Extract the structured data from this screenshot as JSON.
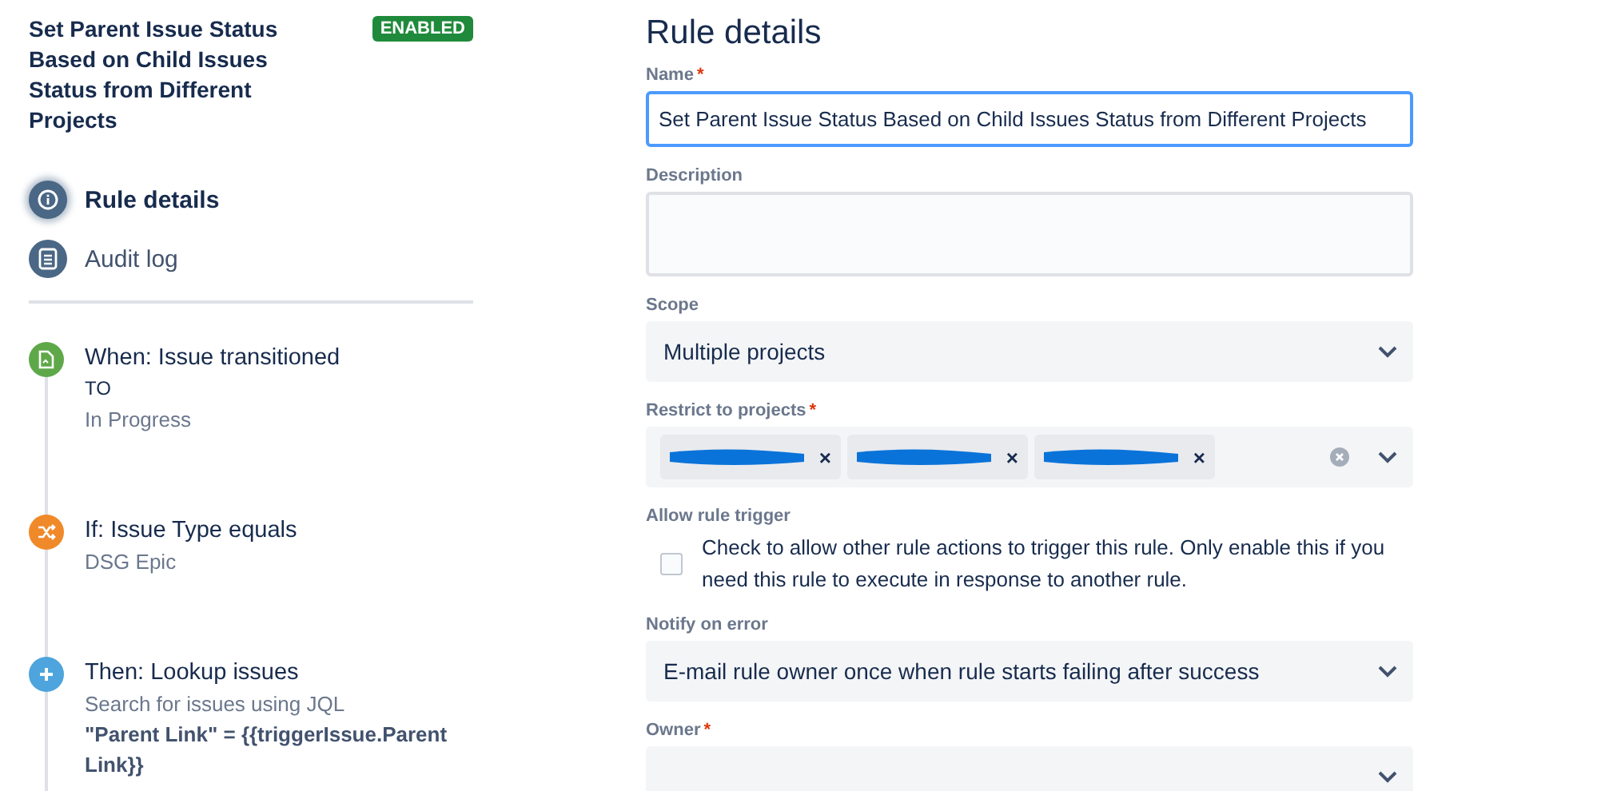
{
  "rule": {
    "title": "Set Parent Issue Status Based on Child Issues Status from Different Projects",
    "status": "ENABLED"
  },
  "nav": [
    {
      "kind": "info",
      "label": "Rule details",
      "selected": true
    },
    {
      "kind": "log",
      "label": "Audit log",
      "selected": false
    }
  ],
  "steps": [
    {
      "kind": "trigger",
      "title": "When: Issue transitioned",
      "lines": [
        {
          "kind": "caps",
          "text": "TO"
        },
        {
          "kind": "plain",
          "text": "In Progress"
        }
      ]
    },
    {
      "kind": "condition",
      "title": "If: Issue Type equals",
      "lines": [
        {
          "kind": "plain",
          "text": "DSG Epic"
        }
      ]
    },
    {
      "kind": "action",
      "title": "Then: Lookup issues",
      "lines": [
        {
          "kind": "plain",
          "text": "Search for issues using JQL"
        },
        {
          "kind": "code",
          "text": "\"Parent Link\" = {{triggerIssue.Parent Link}}"
        }
      ]
    }
  ],
  "form": {
    "heading": "Rule details",
    "fields": [
      {
        "kind": "text",
        "label": "Name",
        "required_mark": "*",
        "value": "Set Parent Issue Status Based on Child Issues Status from Different Projects",
        "focused": true
      },
      {
        "kind": "textarea",
        "label": "Description"
      },
      {
        "kind": "select",
        "label": "Scope",
        "value": "Multiple projects"
      },
      {
        "kind": "tags",
        "label": "Restrict to projects",
        "required_mark": "*",
        "tags": [
          {
            "remove": "×"
          },
          {
            "remove": "×"
          },
          {
            "remove": "×"
          }
        ]
      },
      {
        "kind": "checkbox",
        "label": "Allow rule trigger",
        "text": "Check to allow other rule actions to trigger this rule. Only enable this if you need this rule to execute in response to another rule.",
        "checked": false
      },
      {
        "kind": "select",
        "label": "Notify on error",
        "value": "E-mail rule owner once when rule starts failing after success"
      },
      {
        "kind": "select",
        "label": "Owner",
        "required_mark": "*"
      }
    ]
  }
}
